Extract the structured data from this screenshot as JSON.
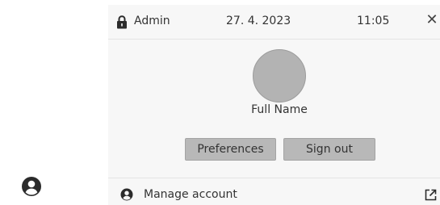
{
  "header": {
    "user_name": "Admin",
    "date": "27. 4. 2023",
    "time": "11:05",
    "close_glyph": "✕",
    "lock_icon": "lock-icon"
  },
  "profile": {
    "full_name": "Full Name"
  },
  "actions": {
    "preferences_label": "Preferences",
    "sign_out_label": "Sign out"
  },
  "footer": {
    "manage_account_label": "Manage account",
    "account_icon": "account-circle-icon",
    "external_icon": "external-link-icon"
  },
  "taskbar": {
    "user_icon": "account-circle-icon"
  },
  "colors": {
    "panel_bg": "#f7f7f7",
    "avatar_fill": "#b3b3b3",
    "button_bg": "#b8b8b8",
    "text": "#333333",
    "icon": "#2b2b2b"
  }
}
